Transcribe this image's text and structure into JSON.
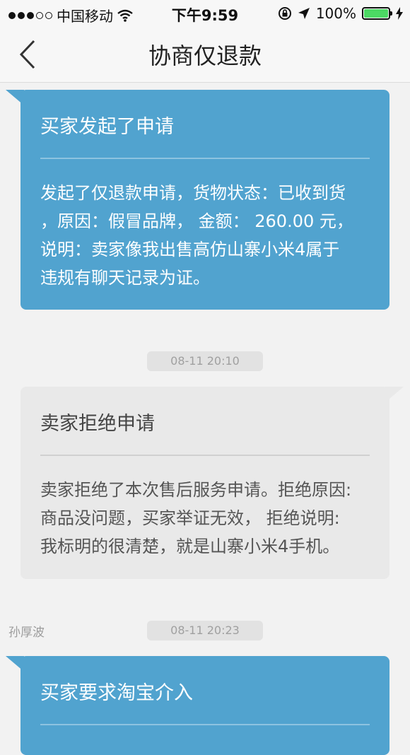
{
  "status_bar": {
    "carrier": "中国移动",
    "time": "下午9:59",
    "battery_percent": "100%",
    "battery_level": 1.0,
    "signal_bars_filled": 3,
    "signal_bars_total": 5
  },
  "nav": {
    "title": "协商仅退款"
  },
  "messages": [
    {
      "title": "买家发起了申请",
      "body": "发起了仅退款申请，货物状态：已收到货\n，原因：假冒品牌， 金额： 260.00 元，\n说明：卖家像我出售高仿山寨小米4属于\n违规有聊天记录为证。"
    },
    {
      "timestamp": "08-11 20:10",
      "title": "卖家拒绝申请",
      "body": "卖家拒绝了本次售后服务申请。拒绝原因:\n商品没问题，买家举证无效， 拒绝说明:\n我标明的很清楚，就是山寨小米4手机。"
    },
    {
      "sender": "孙厚波",
      "timestamp": "08-11 20:23",
      "title": "买家要求淘宝介入"
    }
  ],
  "colors": {
    "buyer_card": "#51a3cf",
    "seller_card": "#e9e9e9",
    "battery_fill": "#4cd964"
  }
}
